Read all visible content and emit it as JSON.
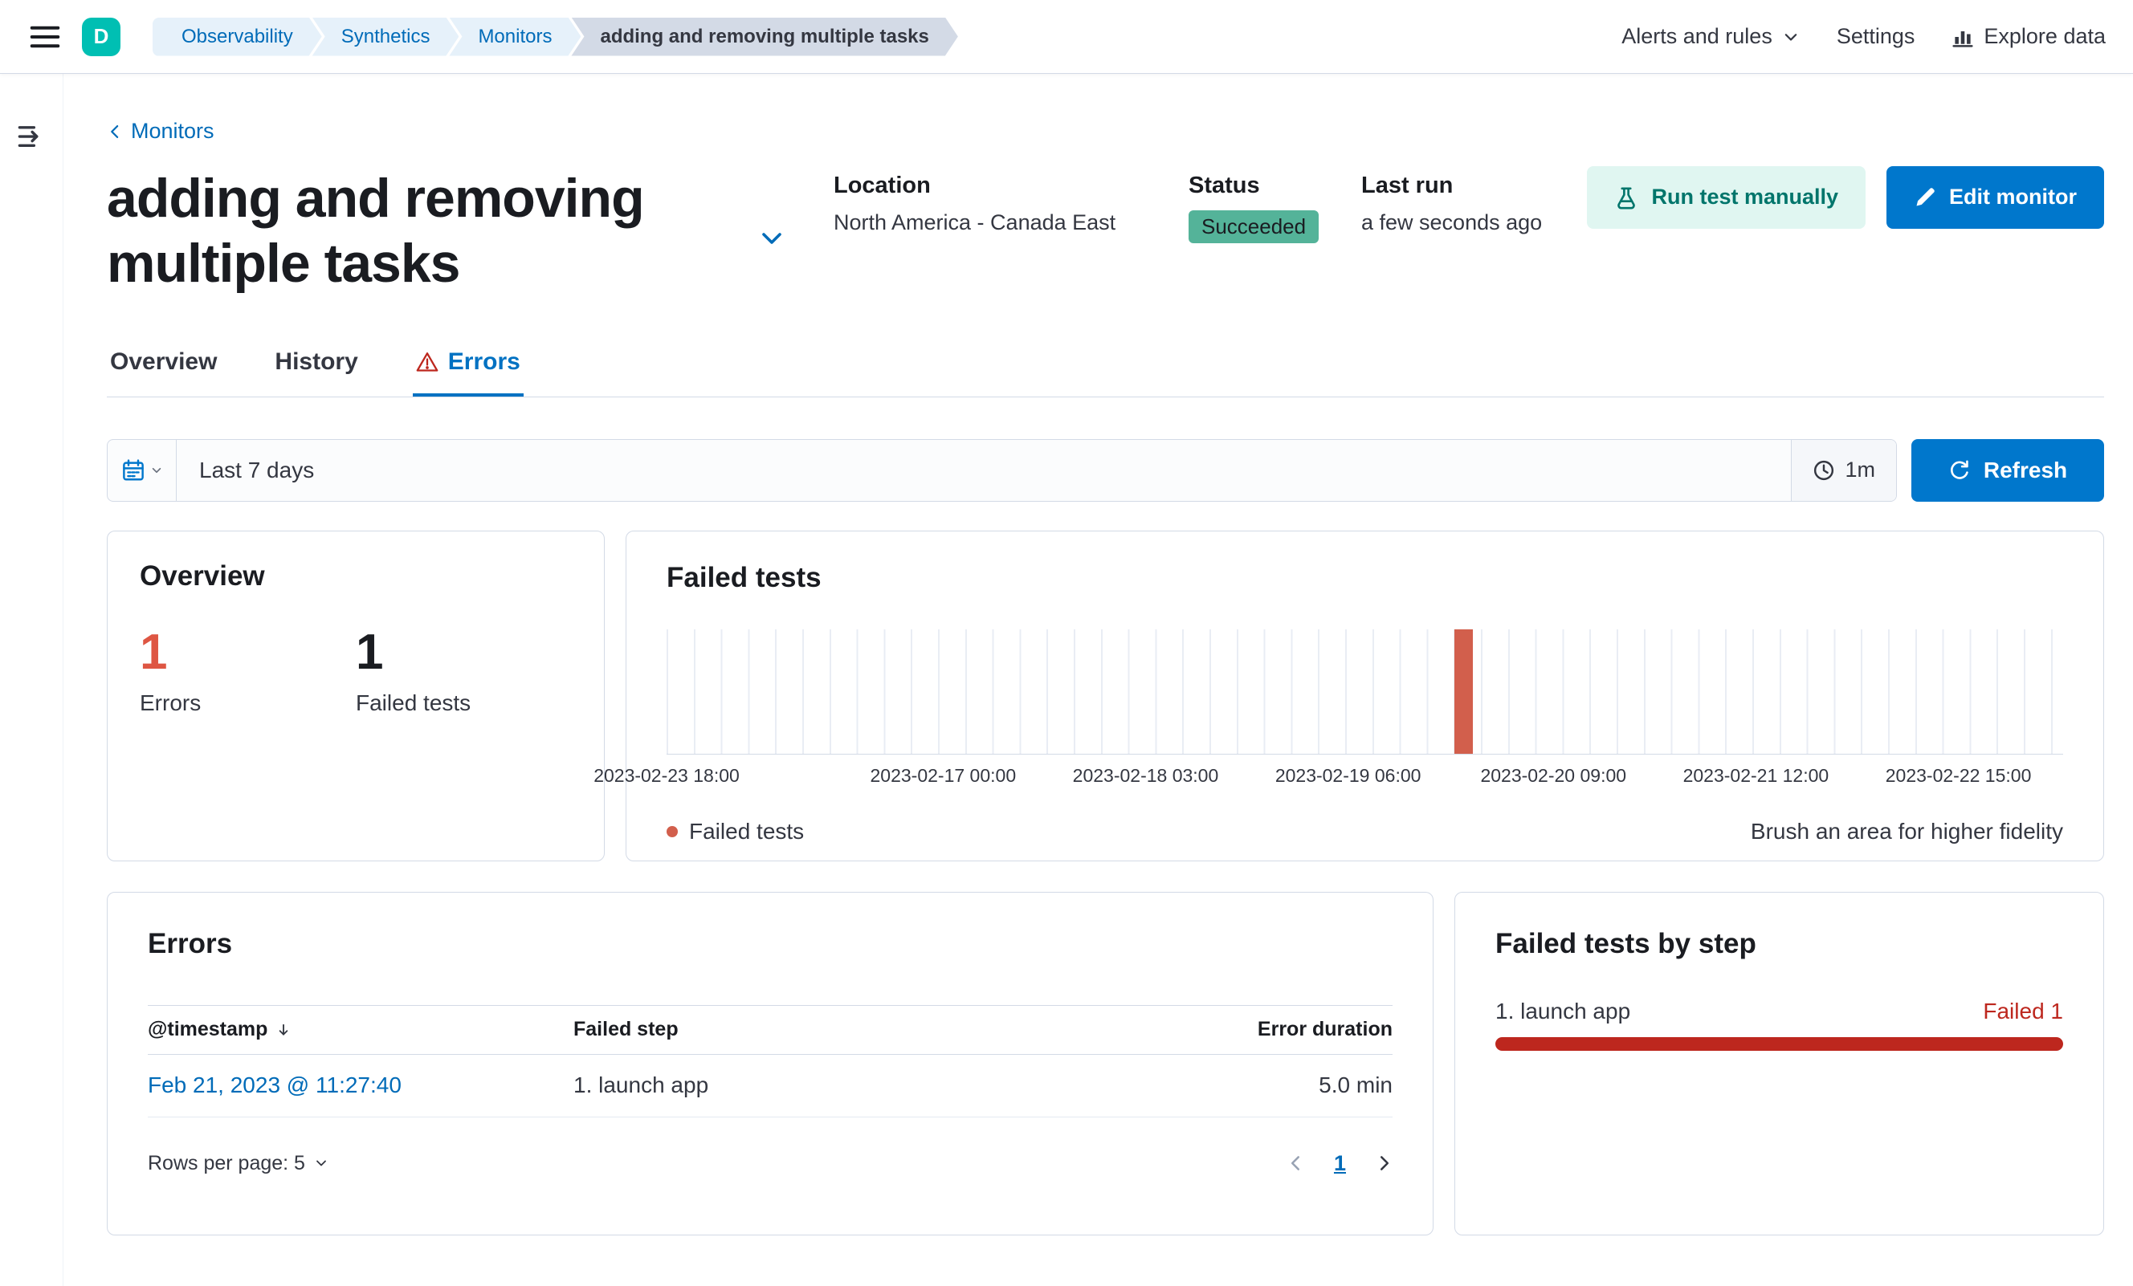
{
  "colors": {
    "primary": "#0077CC",
    "link": "#006BB8",
    "danger_text": "#BD271E",
    "chart_bar": "#D25F4C",
    "error_count": "#DE5643",
    "success_badge_bg": "#54B399",
    "space_badge_bg": "#00BFB3",
    "breadcrumb_bg": "#E6F1FA",
    "breadcrumb_current_bg": "#D3DAE6",
    "border": "#D3DAE6"
  },
  "icons": [
    "hamburger-icon",
    "docked-menu-icon",
    "chevron-left-icon",
    "chevron-down-icon",
    "beaker-icon",
    "pencil-icon",
    "warning-icon",
    "calendar-icon",
    "clock-icon",
    "refresh-icon",
    "explore-data-icon",
    "sort-down-icon",
    "chevron-right-icon",
    "legend-dot"
  ],
  "header": {
    "space_badge": "D",
    "breadcrumbs": [
      {
        "label": "Observability"
      },
      {
        "label": "Synthetics"
      },
      {
        "label": "Monitors"
      },
      {
        "label": "adding and removing multiple tasks"
      }
    ],
    "nav_right": {
      "alerts": "Alerts and rules",
      "settings": "Settings",
      "explore": "Explore data"
    }
  },
  "page": {
    "back_link": "Monitors",
    "title": "adding and removing multiple tasks",
    "meta": {
      "location_label": "Location",
      "location_value": "North America - Canada East",
      "status_label": "Status",
      "status_value": "Succeeded",
      "last_run_label": "Last run",
      "last_run_value": "a few seconds ago"
    },
    "actions": {
      "run_test": "Run test manually",
      "edit_monitor": "Edit monitor"
    },
    "tabs": [
      {
        "label": "Overview",
        "active": false
      },
      {
        "label": "History",
        "active": false
      },
      {
        "label": "Errors",
        "active": true
      }
    ]
  },
  "filter_bar": {
    "date_range": "Last 7 days",
    "refresh_interval": "1m",
    "refresh_label": "Refresh"
  },
  "overview_panel": {
    "title": "Overview",
    "stats": [
      {
        "value": "1",
        "label": "Errors"
      },
      {
        "value": "1",
        "label": "Failed tests"
      }
    ]
  },
  "failed_tests_panel": {
    "title": "Failed tests",
    "hint": "Brush an area for higher fidelity",
    "chart_data": {
      "type": "bar",
      "title": "Failed tests",
      "x_ticks": [
        "2023-02-17 00:00",
        "2023-02-18 03:00",
        "2023-02-19 06:00",
        "2023-02-20 09:00",
        "2023-02-21 12:00",
        "2023-02-22 15:00",
        "2023-02-23 18:00"
      ],
      "series": [
        {
          "name": "Failed tests",
          "points": [
            {
              "x": "2023-02-21 11:27",
              "y": 1
            }
          ]
        }
      ],
      "ylim": [
        0,
        1
      ],
      "grid": "vertical",
      "legend_position": "bottom-left"
    }
  },
  "errors_panel": {
    "title": "Errors",
    "columns": [
      "@timestamp",
      "Failed step",
      "Error duration"
    ],
    "rows": [
      {
        "timestamp": "Feb 21, 2023 @ 11:27:40",
        "failed_step": "1. launch app",
        "error_duration": "5.0 min"
      }
    ],
    "rows_per_page": "Rows per page: 5",
    "page": "1"
  },
  "failed_steps_panel": {
    "title": "Failed tests by step",
    "steps": [
      {
        "label": "1. launch app",
        "status": "Failed 1"
      }
    ]
  }
}
